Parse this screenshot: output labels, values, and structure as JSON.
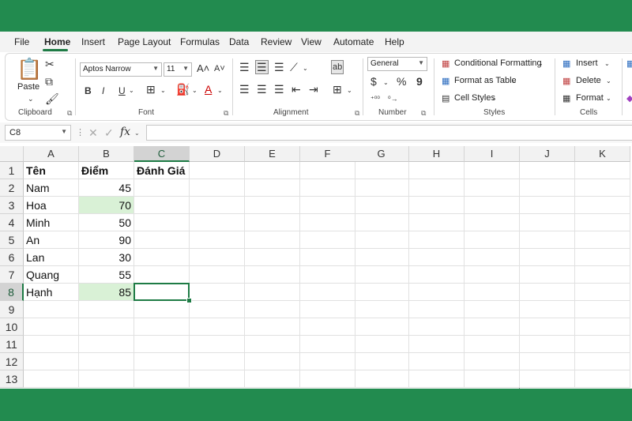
{
  "menu": [
    "File",
    "Home",
    "Insert",
    "Page Layout",
    "Formulas",
    "Data",
    "Review",
    "View",
    "Automate",
    "Help"
  ],
  "clipboard": {
    "paste_label": "Paste",
    "group_label": "Clipboard"
  },
  "font": {
    "name": "Aptos Narrow",
    "size": "11",
    "group_label": "Font",
    "bold": "B",
    "italic": "I",
    "underline": "U"
  },
  "alignment": {
    "group_label": "Alignment"
  },
  "number": {
    "format": "General",
    "currency": "$",
    "percent": "%",
    "comma": "9",
    "group_label": "Number"
  },
  "styles": {
    "conditional": "Conditional Formatting",
    "format_table": "Format as Table",
    "cell_styles": "Cell Styles",
    "group_label": "Styles"
  },
  "cells": {
    "insert": "Insert",
    "delete": "Delete",
    "format": "Format",
    "group_label": "Cells"
  },
  "formula_bar": {
    "name_box": "C8",
    "fx": "fx",
    "formula": ""
  },
  "columns": [
    "A",
    "B",
    "C",
    "D",
    "E",
    "F",
    "G",
    "H",
    "I",
    "J",
    "K"
  ],
  "rows": [
    "1",
    "2",
    "3",
    "4",
    "5",
    "6",
    "7",
    "8",
    "9",
    "10",
    "11",
    "12",
    "13"
  ],
  "sheet": {
    "A": [
      "Tên",
      "Nam",
      "Hoa",
      "Minh",
      "An",
      "Lan",
      "Quang",
      "Hạnh"
    ],
    "B": [
      "Điểm",
      "45",
      "70",
      "50",
      "90",
      "30",
      "55",
      "85"
    ],
    "C": [
      "Đánh Giá"
    ]
  },
  "selected_cell": "C8",
  "highlight_color": "#d9f1d6",
  "accent_color": "#1e7b45"
}
